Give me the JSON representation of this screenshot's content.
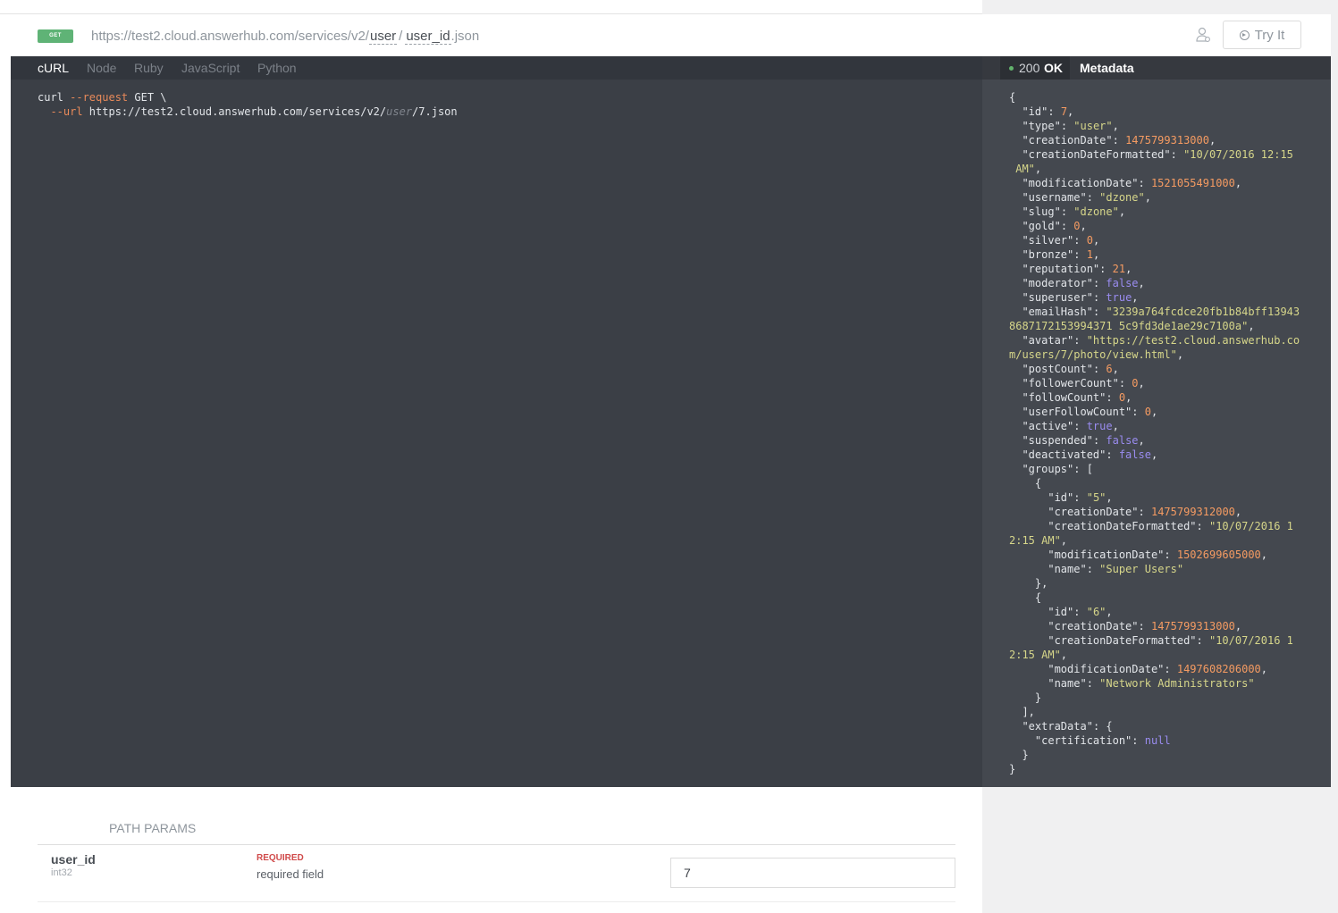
{
  "request": {
    "method": "GET",
    "url_prefix": "https://test2.cloud.answerhub.com/services/v2/",
    "url_seg1": "user",
    "url_sep": "/",
    "url_seg2": "user_id",
    "url_suffix": ".json",
    "try_label": "Try It"
  },
  "code_tabs": [
    "cURL",
    "Node",
    "Ruby",
    "JavaScript",
    "Python"
  ],
  "code": {
    "line1_cmd": "curl ",
    "line1_flag": "--request",
    "line1_rest": " GET \\",
    "line2_indent": "  ",
    "line2_flag": "--url",
    "line2_base": " https://test2.cloud.answerhub.com/services/v2/",
    "line2_placeholder": "user",
    "line2_end": "/7.json"
  },
  "response": {
    "status_code": "200",
    "status_text": "OK",
    "metadata_tab": "Metadata"
  },
  "path_params": {
    "title": "PATH PARAMS",
    "name": "user_id",
    "type": "int32",
    "required": "REQUIRED",
    "description": "required field",
    "value": "7"
  },
  "colors": {
    "method_badge": "#5fb376",
    "code_bg": "#3b3f46",
    "response_bg": "#44484f",
    "json_string": "#d6d68a",
    "json_number": "#f59b62",
    "json_boolean": "#9a8cf0",
    "required": "#d04a4a"
  }
}
